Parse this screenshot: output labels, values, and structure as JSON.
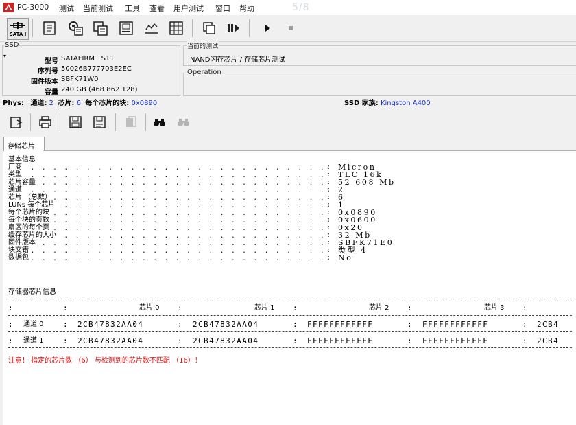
{
  "app": {
    "title": "PC-3000",
    "menu": [
      "测试",
      "当前测试",
      "工具",
      "查看",
      "用户测试",
      "窗口",
      "帮助"
    ],
    "counter": "5/8"
  },
  "toolbar": {
    "sata_label": "SATA I",
    "icons": [
      "sata-icon",
      "document-icon",
      "chip-settings-icon",
      "chip-tool-icon",
      "disk-icon",
      "utility-icon",
      "grid-icon",
      "copy-icon",
      "play-pause-icon",
      "play-icon",
      "stop-icon"
    ]
  },
  "ssd": {
    "group_label": "SSD",
    "model_key": "型号",
    "model": "SATAFIRM   S11",
    "serial_key": "序列号",
    "serial": "50026B777703E2EC",
    "firmware_key": "固件版本",
    "firmware": "SBFK71W0",
    "capacity_key": "容量",
    "capacity": "240 GB (468 862 128)"
  },
  "current_test": {
    "group_label": "当前的测试",
    "value": "NAND闪存芯片 / 存储芯片测试",
    "operation_label": "Operation"
  },
  "phys": {
    "label": "Phys:",
    "channel_key": "通道:",
    "channel": "2",
    "chip_key": "芯片:",
    "chip": "6",
    "blocks_key": "每个芯片的块:",
    "blocks": "0x0890",
    "family_key": "SSD 家族:",
    "family": "Kingston A400"
  },
  "tab": {
    "label": "存储芯片"
  },
  "basic": {
    "title": "基本信息",
    "rows": [
      {
        "k": "厂商",
        "v": "Micron"
      },
      {
        "k": "类型",
        "v": "TLC 16k"
      },
      {
        "k": "芯片容量",
        "v": "52 608 Mb"
      },
      {
        "k": "通道",
        "v": "2"
      },
      {
        "k": "芯片 （总数）",
        "v": "6"
      },
      {
        "k": "LUNs 每个芯片",
        "v": "1"
      },
      {
        "k": "每个芯片的块",
        "v": "0x0890"
      },
      {
        "k": "每个块的页数",
        "v": "0x0600"
      },
      {
        "k": "扇区的每个页",
        "v": "0x20"
      },
      {
        "k": "缓存芯片的大小",
        "v": "32 Mb"
      },
      {
        "k": "固件版本",
        "v": "SBFK71E0"
      },
      {
        "k": "块交错",
        "v": "类型 4"
      },
      {
        "k": "数据包",
        "v": "No"
      }
    ]
  },
  "chipinfo": {
    "title": "存储器芯片信息",
    "headers": [
      "芯片 0",
      "芯片 1",
      "芯片 2",
      "芯片 3"
    ],
    "rows": [
      {
        "label": "通道 0",
        "cells": [
          "2CB47832AA04",
          "2CB47832AA04",
          "FFFFFFFFFFFF",
          "FFFFFFFFFFFF",
          "2CB4"
        ]
      },
      {
        "label": "通道 1",
        "cells": [
          "2CB47832AA04",
          "2CB47832AA04",
          "FFFFFFFFFFFF",
          "FFFFFFFFFFFF",
          "2CB4"
        ]
      }
    ]
  },
  "warning": "注意！  指定的芯片数  （6）  与检测到的芯片数不匹配  （16）！",
  "colors": {
    "accent_blue": "#1b33c8",
    "warning_red": "#e01010",
    "logo_red": "#d42222"
  }
}
